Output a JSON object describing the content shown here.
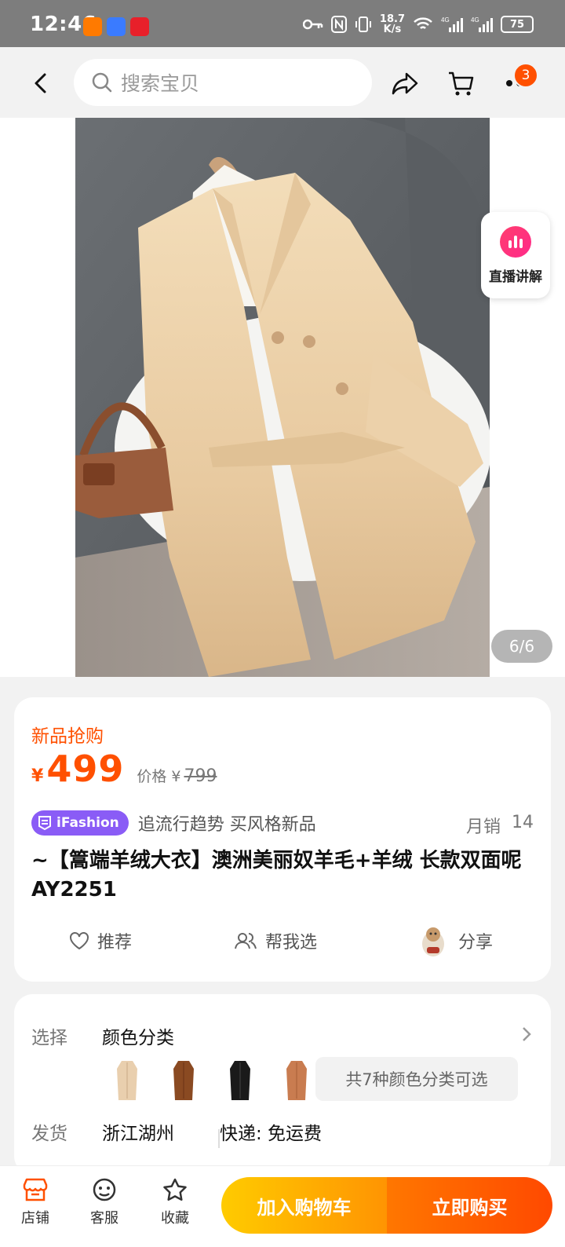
{
  "status_bar": {
    "time": "12:46",
    "net_speed_top": "18.7",
    "net_speed_bottom": "K/s",
    "battery": "75"
  },
  "nav": {
    "search_placeholder": "搜索宝贝",
    "cart_badge": "3"
  },
  "gallery": {
    "live_label": "直播讲解",
    "page_counter": "6/6"
  },
  "product": {
    "promo_label": "新品抢购",
    "currency": "¥",
    "price": "499",
    "original_label": "价格",
    "original_currency": "¥",
    "original_price": "799",
    "tag_brand": "iFashion",
    "tag_slogan": "追流行趋势 买风格新品",
    "monthly_sales_label": "月销",
    "monthly_sales": "14",
    "title": "~【篙端羊绒大衣】澳洲美丽奴羊毛+羊绒 长款双面呢AY2251"
  },
  "actions": {
    "recommend": "推荐",
    "help_choose": "帮我选",
    "share": "分享"
  },
  "selection": {
    "select_label": "选择",
    "select_value": "颜色分类",
    "swatch_colors": [
      "#e9cfae",
      "#8a4a22",
      "#1a1a1a",
      "#c97c50"
    ],
    "color_count": "共7种颜色分类可选",
    "ship_label": "发货",
    "ship_from": "浙江湖州",
    "express": "快递: 免运费"
  },
  "bottom_bar": {
    "store": "店铺",
    "service": "客服",
    "favorite": "收藏",
    "add_to_cart": "加入购物车",
    "buy_now": "立即购买"
  },
  "colors": {
    "accent": "#ff5000",
    "brand_purple": "#8a5cf6"
  }
}
